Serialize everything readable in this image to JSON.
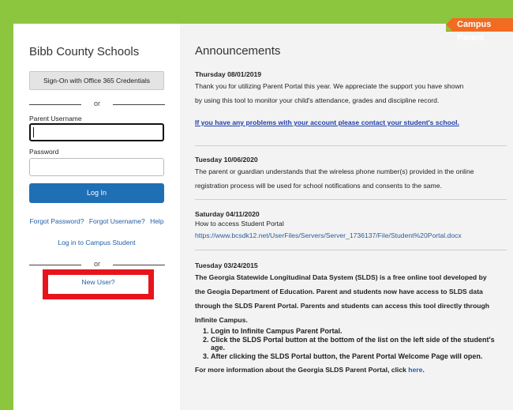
{
  "badge": "Campus Parent",
  "login": {
    "district": "Bibb County Schools",
    "o365_button": "Sign-On with Office 365 Credentials",
    "or_text": "or",
    "username_label": "Parent Username",
    "username_value": "",
    "password_label": "Password",
    "password_value": "",
    "login_button": "Log In",
    "forgot_password": "Forgot Password?",
    "forgot_username": "Forgot Username?",
    "help": "Help",
    "campus_student": "Log in to Campus Student",
    "new_user": "New User?"
  },
  "announcements": {
    "title": "Announcements",
    "items": [
      {
        "date": "Thursday 08/01/2019",
        "line1": "Thank you for utilizing Parent Portal this year.  We appreciate the support you have shown",
        "line2": "by using this tool to monitor your child's attendance, grades and discipline record.",
        "link": "If you have any problems with your account please contact your student's school."
      },
      {
        "date": "Tuesday 10/06/2020",
        "line1": "The parent or guardian understands that the wireless phone number(s) provided in the online",
        "line2": "registration process will be used for school notifications and consents to the same."
      },
      {
        "date": "Saturday 04/11/2020",
        "line1": "How to access Student Portal",
        "url": "https://www.bcsdk12.net/UserFiles/Servers/Server_1736137/File/Student%20Portal.docx"
      },
      {
        "date": "Tuesday 03/24/2015",
        "p1": "The Georgia Statewide Longitudinal Data System (SLDS) is a free online tool developed by",
        "p2": "the Geogia Department of Education. Parent and students now have access to SLDS data",
        "p3": "through the SLDS Parent Portal. Parents and students can access this tool directly through",
        "p4": "Infinite Campus.",
        "steps": [
          "Login to Infinite Campus Parent Portal.",
          "Click the SLDS Portal button at the bottom of the list on the left side of the student's age.",
          "After clicking the SLDS Portal button, the Parent Portal Welcome Page will open."
        ],
        "more_prefix": "For more information about the Georgia SLDS Parent Portal, click ",
        "more_link": "here",
        "more_suffix": "."
      }
    ]
  },
  "colors": {
    "background": "#8cc63f",
    "badge": "#f26b22",
    "primary_button": "#1f6fb5",
    "highlight": "#e8141c"
  }
}
